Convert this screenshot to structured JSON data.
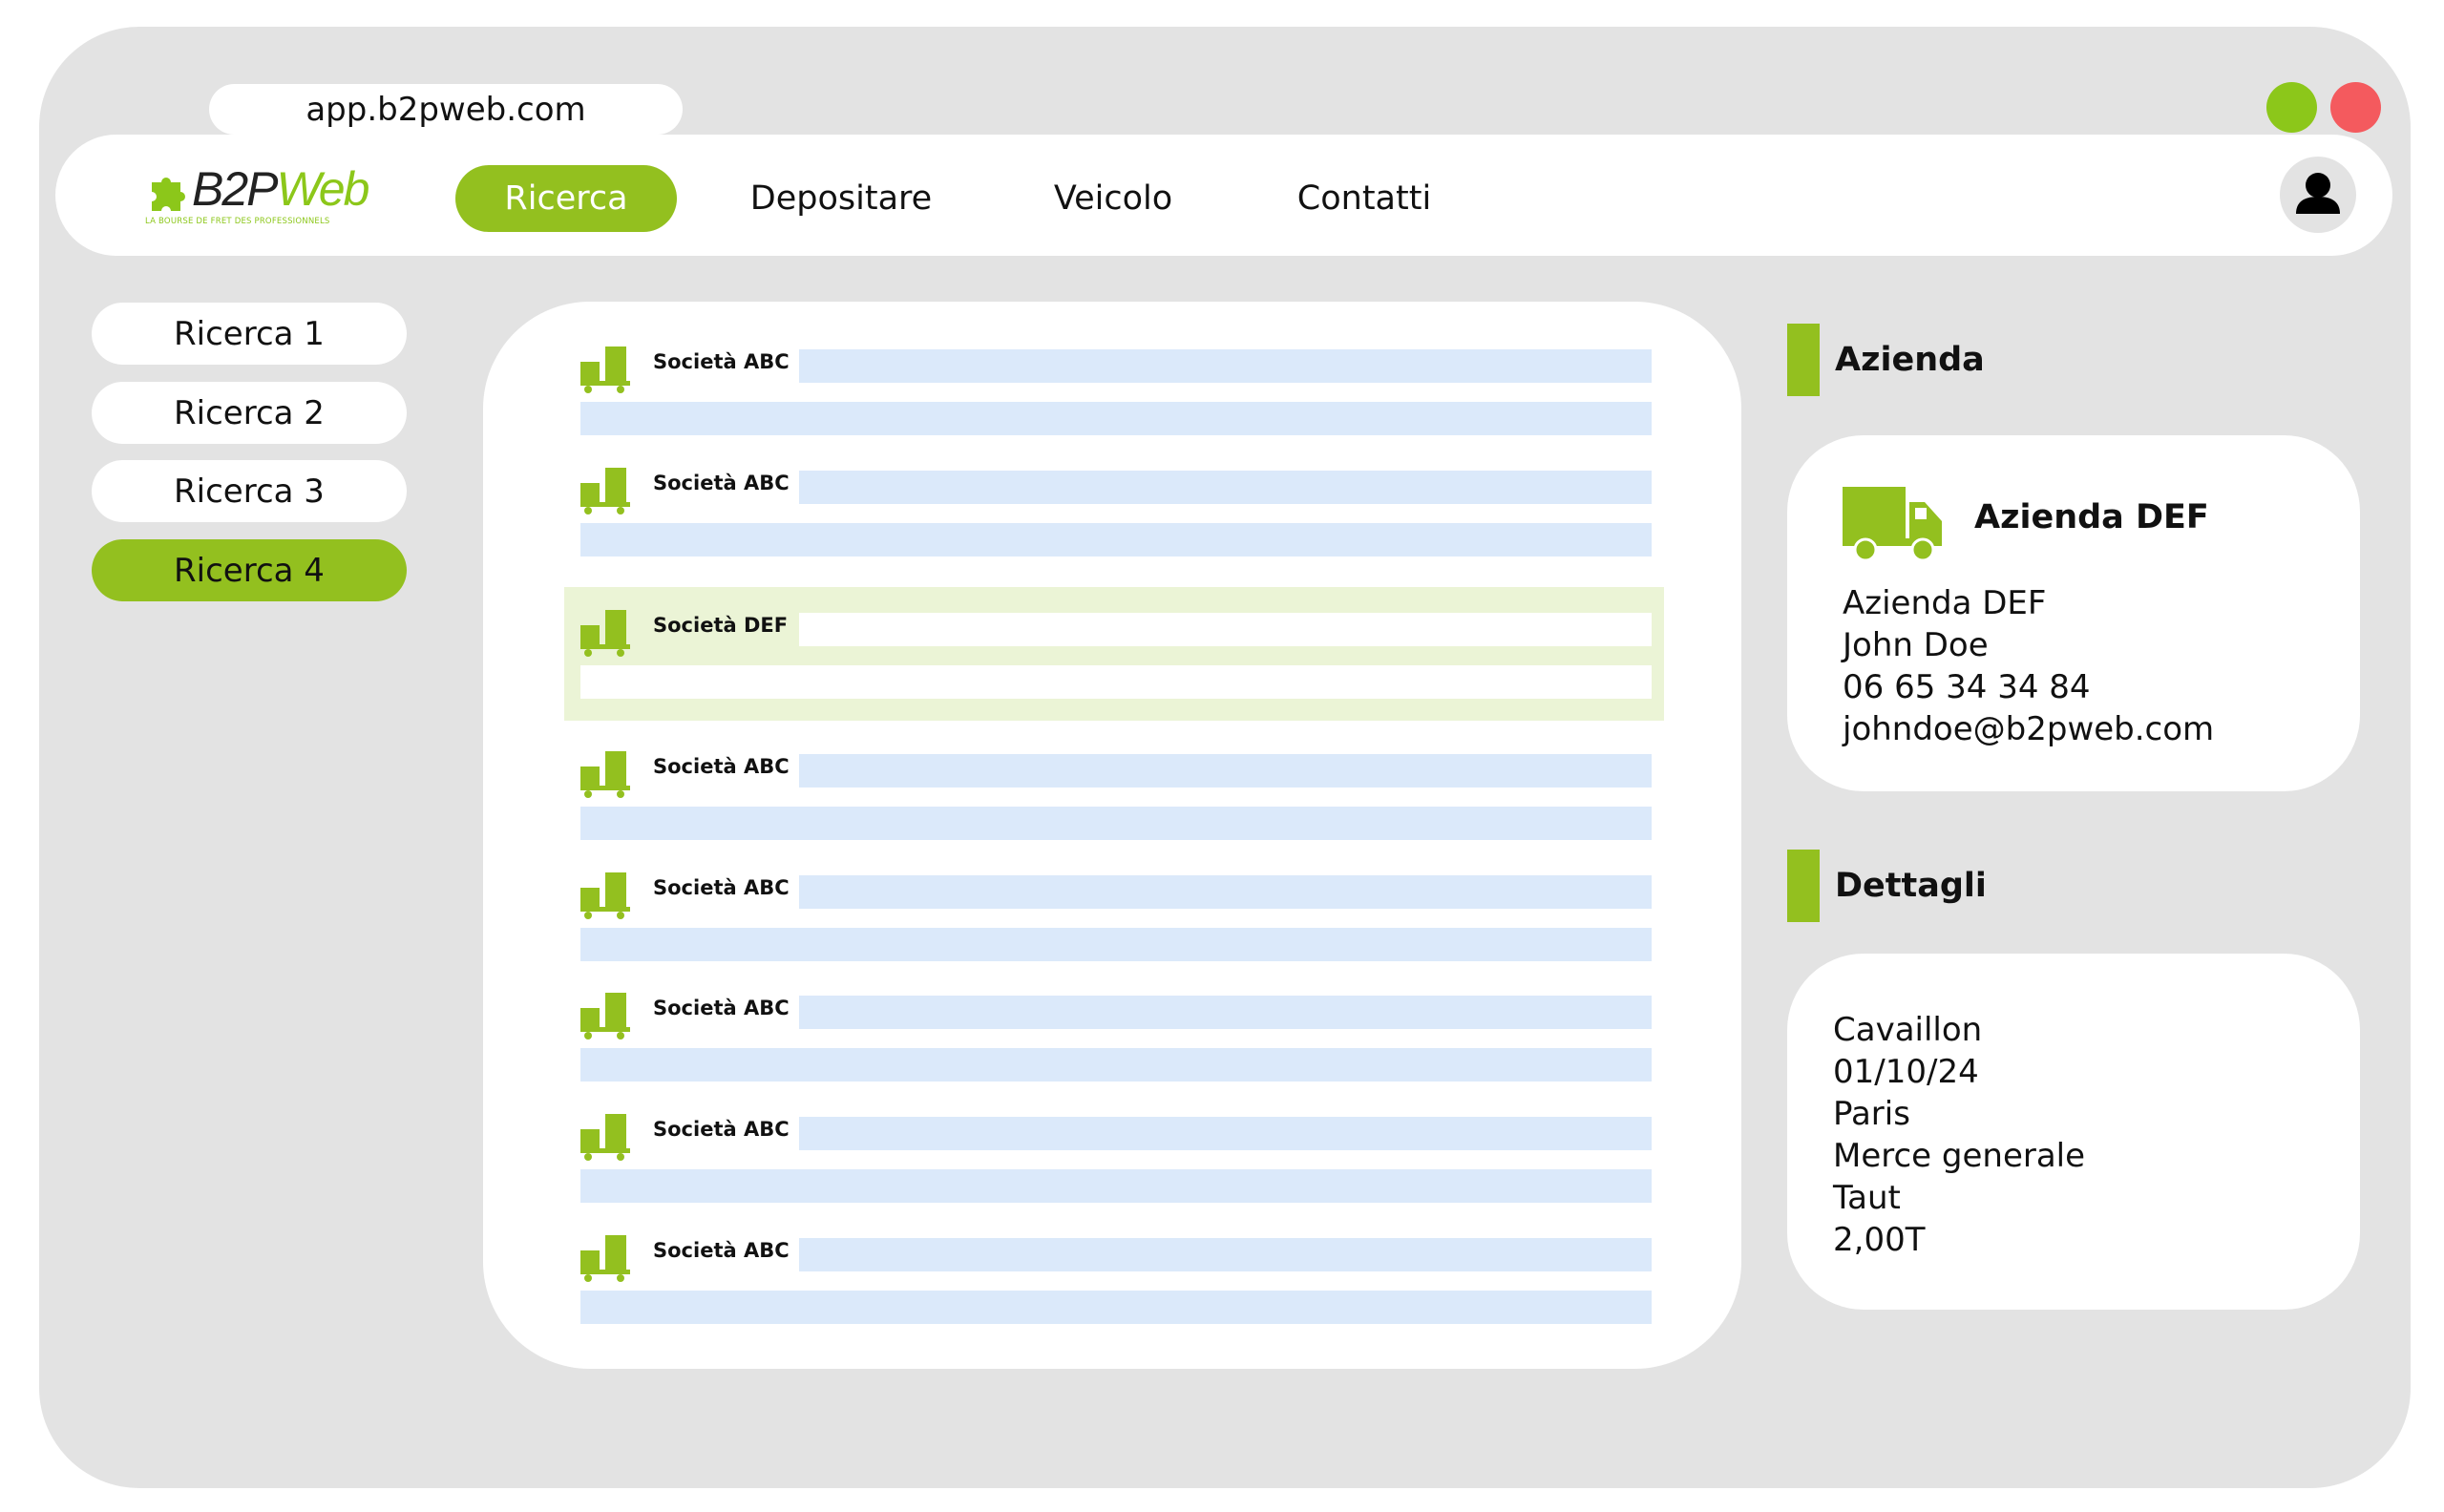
{
  "browser": {
    "url": "app.b2pweb.com"
  },
  "header": {
    "logo_brand_a": "B2P",
    "logo_brand_b": "Web",
    "logo_tagline": "LA BOURSE DE FRET DES PROFESSIONNELS",
    "nav": [
      {
        "label": "Ricerca",
        "active": true
      },
      {
        "label": "Depositare",
        "active": false
      },
      {
        "label": "Veicolo",
        "active": false
      },
      {
        "label": "Contatti",
        "active": false
      }
    ]
  },
  "sidebar": {
    "items": [
      {
        "label": "Ricerca 1",
        "active": false
      },
      {
        "label": "Ricerca 2",
        "active": false
      },
      {
        "label": "Ricerca 3",
        "active": false
      },
      {
        "label": "Ricerca 4",
        "active": true
      }
    ]
  },
  "results": {
    "rows": [
      {
        "company": "Società ABC",
        "selected": false
      },
      {
        "company": "Società ABC",
        "selected": false
      },
      {
        "company": "Società DEF",
        "selected": true
      },
      {
        "company": "Società ABC",
        "selected": false
      },
      {
        "company": "Società ABC",
        "selected": false
      },
      {
        "company": "Società ABC",
        "selected": false
      },
      {
        "company": "Società ABC",
        "selected": false
      },
      {
        "company": "Società ABC",
        "selected": false
      }
    ]
  },
  "company_section": {
    "heading": "Azienda",
    "card_title": "Azienda DEF",
    "lines": [
      "Azienda DEF",
      "John Doe",
      "06 65 34 34 84",
      "johndoe@b2pweb.com"
    ]
  },
  "details_section": {
    "heading": "Dettagli",
    "lines": [
      "Cavaillon",
      "01/10/24",
      "Paris",
      "Merce generale",
      "Taut",
      "2,00T"
    ]
  },
  "colors": {
    "accent_green": "#93c01f",
    "window_dot_green": "#8cc71a",
    "window_dot_red": "#f45a5e",
    "row_bar_blue": "#dbe9fa",
    "selected_row_bg": "#ebf4d6",
    "frame_bg": "#e3e3e3"
  },
  "icons": {
    "row": "truck-cargo-icon",
    "company": "delivery-truck-icon",
    "user": "user-icon",
    "logo": "puzzle-piece-icon"
  }
}
